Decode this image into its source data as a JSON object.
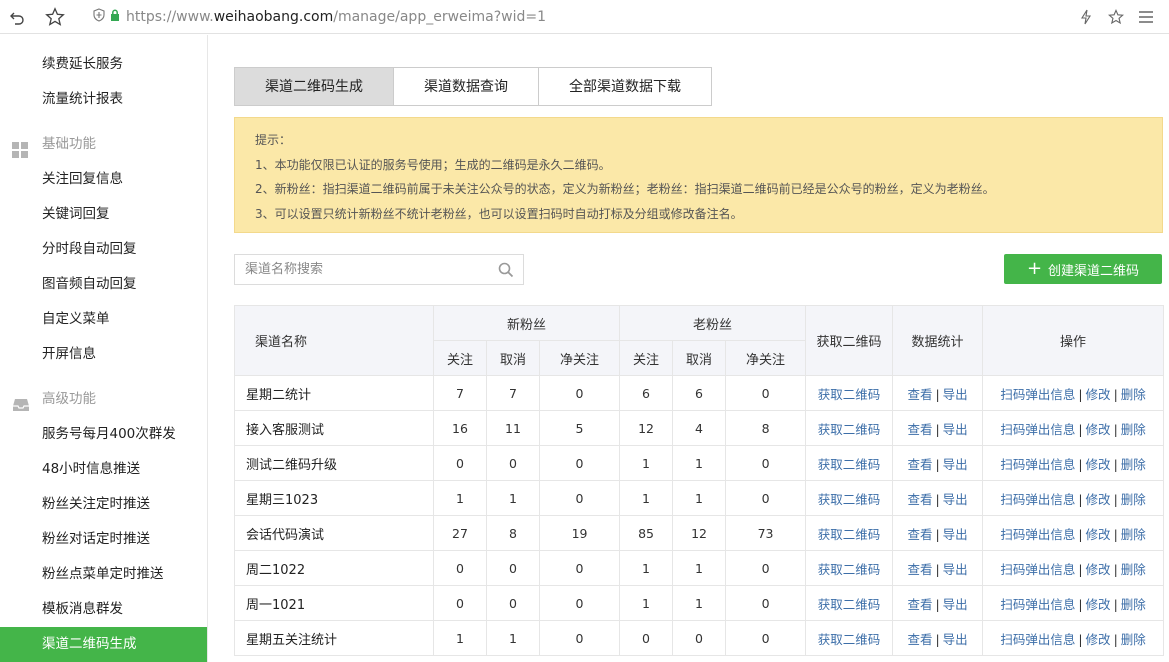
{
  "browser": {
    "url_prefix": "https://www.",
    "url_host": "weihaobang.com",
    "url_path": "/manage/app_erweima?wid=1"
  },
  "sidebar": {
    "items_top": [
      {
        "label": "续费延长服务"
      },
      {
        "label": "流量统计报表"
      }
    ],
    "group_basic": {
      "label": "基础功能",
      "icon": "grid-icon"
    },
    "items_basic": [
      {
        "label": "关注回复信息"
      },
      {
        "label": "关键词回复"
      },
      {
        "label": "分时段自动回复"
      },
      {
        "label": "图音频自动回复"
      },
      {
        "label": "自定义菜单"
      },
      {
        "label": "开屏信息"
      }
    ],
    "group_advanced": {
      "label": "高级功能",
      "icon": "inbox-icon"
    },
    "items_advanced": [
      {
        "label": "服务号每月400次群发"
      },
      {
        "label": "48小时信息推送"
      },
      {
        "label": "粉丝关注定时推送"
      },
      {
        "label": "粉丝对话定时推送"
      },
      {
        "label": "粉丝点菜单定时推送"
      },
      {
        "label": "模板消息群发"
      },
      {
        "label": "渠道二维码生成",
        "active": true
      }
    ],
    "active_color": "#44b549"
  },
  "tabs": [
    {
      "label": "渠道二维码生成",
      "active": true
    },
    {
      "label": "渠道数据查询"
    },
    {
      "label": "全部渠道数据下载"
    }
  ],
  "tip": {
    "title": "提示：",
    "lines": [
      "1、本功能仅限已认证的服务号使用；生成的二维码是永久二维码。",
      "2、新粉丝：指扫渠道二维码前属于未关注公众号的状态，定义为新粉丝；老粉丝：指扫渠道二维码前已经是公众号的粉丝，定义为老粉丝。",
      "3、可以设置只统计新粉丝不统计老粉丝，也可以设置扫码时自动打标及分组或修改备注名。"
    ],
    "bg_color": "#fbe8a8"
  },
  "search": {
    "placeholder": "渠道名称搜索",
    "value": ""
  },
  "create_button": {
    "label": "创建渠道二维码",
    "color": "#44b549"
  },
  "table": {
    "headers": {
      "name": "渠道名称",
      "new_fans": "新粉丝",
      "old_fans": "老粉丝",
      "get_qr": "获取二维码",
      "stats": "数据统计",
      "ops": "操作",
      "follow": "关注",
      "cancel": "取消",
      "net": "净关注"
    },
    "link_labels": {
      "get_qr": "获取二维码",
      "view": "查看",
      "export": "导出",
      "popup": "扫码弹出信息",
      "edit": "修改",
      "delete": "删除"
    },
    "rows": [
      {
        "name": "星期二统计",
        "nf": "7",
        "nc": "7",
        "nn": "0",
        "of": "6",
        "oc": "6",
        "on": "0"
      },
      {
        "name": "接入客服测试",
        "nf": "16",
        "nc": "11",
        "nn": "5",
        "of": "12",
        "oc": "4",
        "on": "8"
      },
      {
        "name": "测试二维码升级",
        "nf": "0",
        "nc": "0",
        "nn": "0",
        "of": "1",
        "oc": "1",
        "on": "0"
      },
      {
        "name": "星期三1023",
        "nf": "1",
        "nc": "1",
        "nn": "0",
        "of": "1",
        "oc": "1",
        "on": "0"
      },
      {
        "name": "会话代码演试",
        "nf": "27",
        "nc": "8",
        "nn": "19",
        "of": "85",
        "oc": "12",
        "on": "73"
      },
      {
        "name": "周二1022",
        "nf": "0",
        "nc": "0",
        "nn": "0",
        "of": "1",
        "oc": "1",
        "on": "0"
      },
      {
        "name": "周一1021",
        "nf": "0",
        "nc": "0",
        "nn": "0",
        "of": "1",
        "oc": "1",
        "on": "0"
      },
      {
        "name": "星期五关注统计",
        "nf": "1",
        "nc": "1",
        "nn": "0",
        "of": "0",
        "oc": "0",
        "on": "0"
      }
    ]
  }
}
